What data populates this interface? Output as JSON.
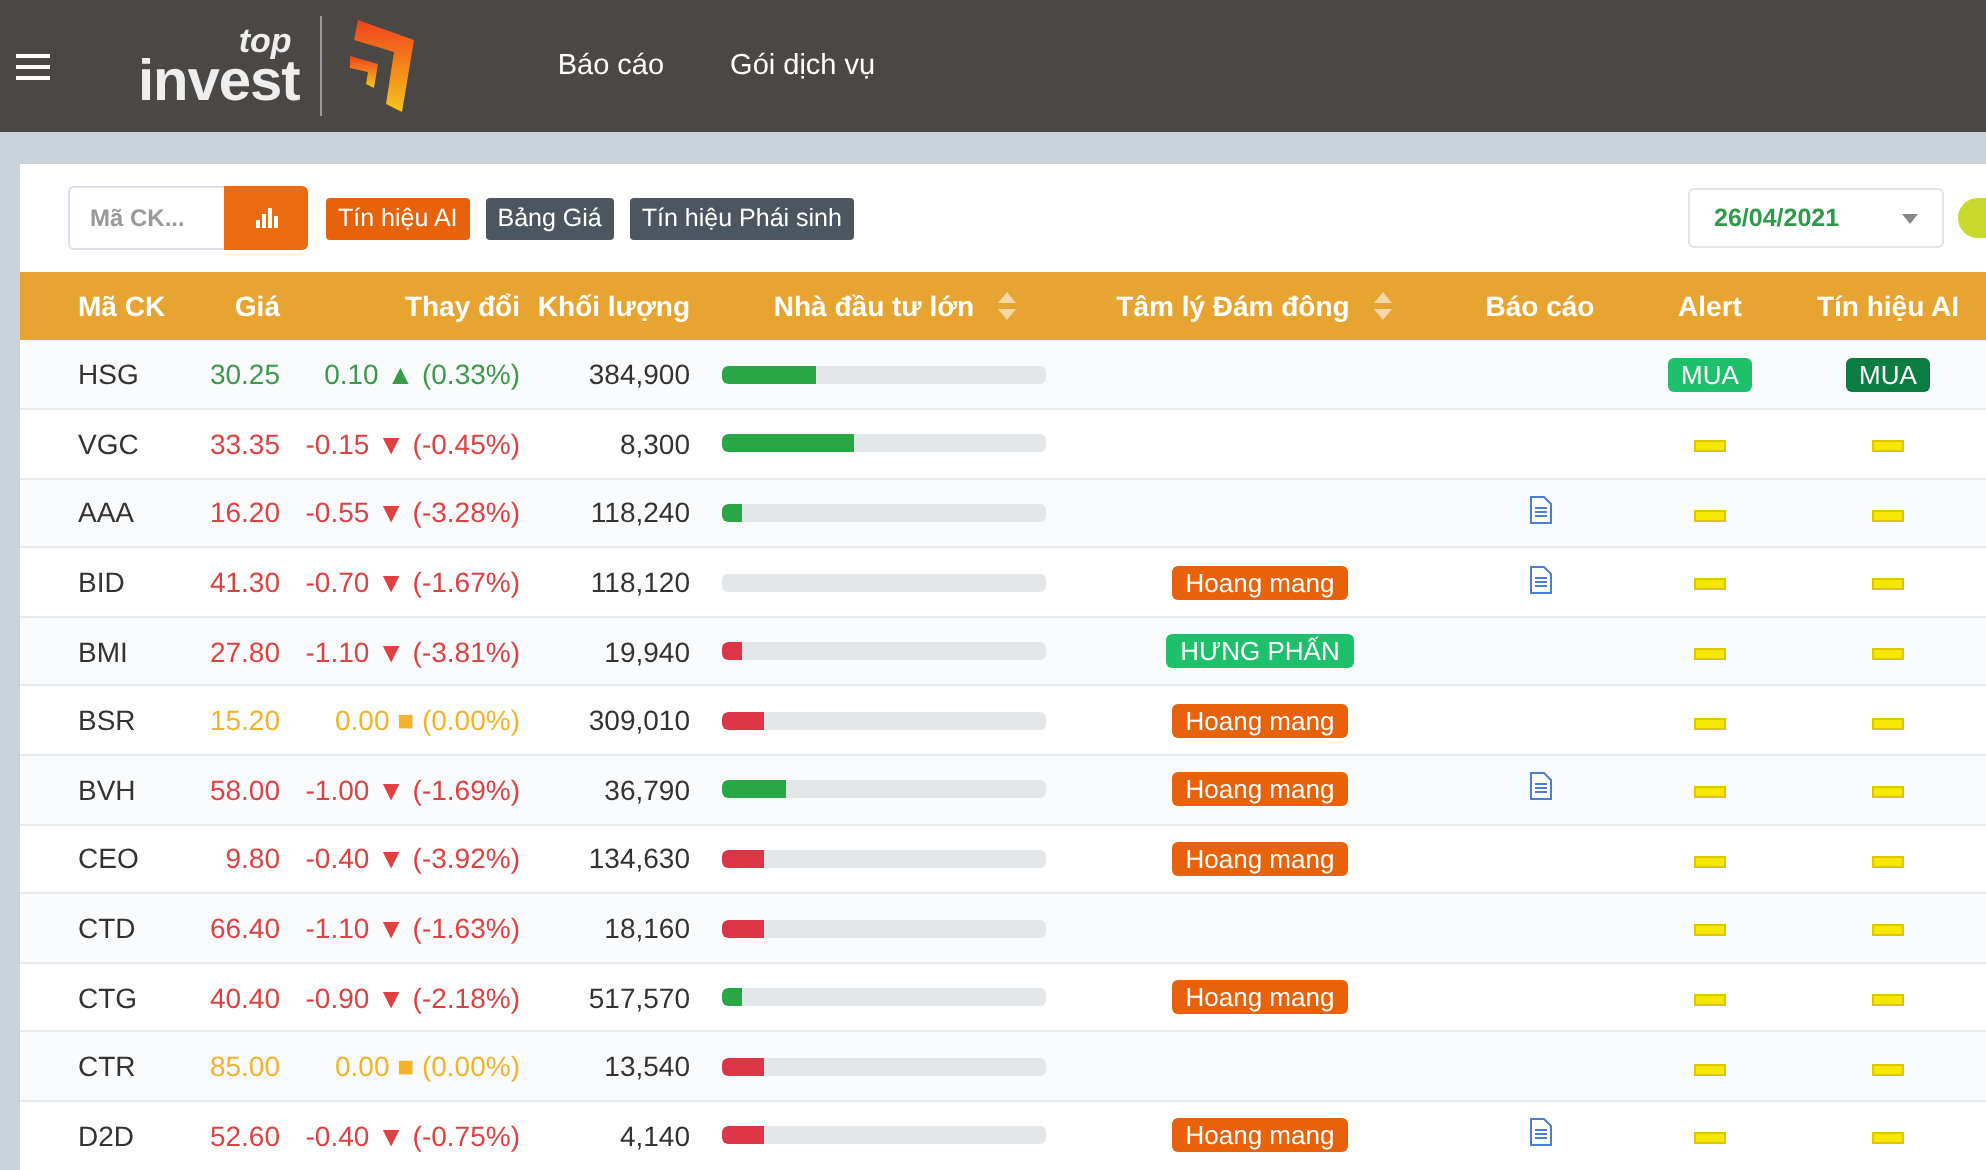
{
  "header": {
    "logo_top": "top",
    "logo_main": "invest",
    "nav": [
      "Báo cáo",
      "Gói dịch vụ"
    ]
  },
  "toolbar": {
    "search": {
      "placeholder": "Mã CK..."
    },
    "tabs": [
      {
        "label": "Tín hiệu AI",
        "selected": true
      },
      {
        "label": "Bảng Giá",
        "selected": false
      },
      {
        "label": "Tín hiệu Phái sinh",
        "selected": false
      }
    ],
    "date": "26/04/2021"
  },
  "table": {
    "columns": [
      {
        "label": "Mã CK",
        "sortable": false
      },
      {
        "label": "Giá",
        "sortable": false
      },
      {
        "label": "Thay đổi",
        "sortable": false
      },
      {
        "label": "Khối lượng",
        "sortable": false
      },
      {
        "label": "Nhà đầu tư lớn",
        "sortable": true
      },
      {
        "label": "Tâm lý Đám đông",
        "sortable": true
      },
      {
        "label": "Báo cáo",
        "sortable": false
      },
      {
        "label": "Alert",
        "sortable": false
      },
      {
        "label": "Tín hiệu AI",
        "sortable": false
      }
    ],
    "rows": [
      {
        "code": "HSG",
        "price": "30.25",
        "change": "0.10 ▲ (0.33%)",
        "kind": "up",
        "volume": "384,900",
        "level": 0.29,
        "color": "#28a745",
        "report": false,
        "alert": "MUA",
        "ai_signal": "MUA"
      },
      {
        "code": "VGC",
        "price": "33.35",
        "change": "-0.15 ▼ (-0.45%)",
        "kind": "down",
        "volume": "8,300",
        "level": 0.41,
        "color": "#28a745",
        "report": false
      },
      {
        "code": "AAA",
        "price": "16.20",
        "change": "-0.55 ▼ (-3.28%)",
        "kind": "down",
        "volume": "118,240",
        "level": 0.06,
        "color": "#28a745",
        "report": true
      },
      {
        "code": "BID",
        "price": "41.30",
        "change": "-0.70 ▼ (-1.67%)",
        "kind": "down",
        "volume": "118,120",
        "level": 0,
        "sentiment": {
          "label": "Hoang mang",
          "color": "#e8620c"
        },
        "report": true
      },
      {
        "code": "BMI",
        "price": "27.80",
        "change": "-1.10 ▼ (-3.81%)",
        "kind": "down",
        "volume": "19,940",
        "level": 0.06,
        "color": "#dc3545",
        "sentiment": {
          "label": "HƯNG PHẤN",
          "color": "#1ec06b"
        },
        "report": false
      },
      {
        "code": "BSR",
        "price": "15.20",
        "change": "0.00 ■ (0.00%)",
        "kind": "flat",
        "volume": "309,010",
        "level": 0.13,
        "color": "#dc3545",
        "sentiment": {
          "label": "Hoang mang",
          "color": "#e8620c"
        },
        "report": false
      },
      {
        "code": "BVH",
        "price": "58.00",
        "change": "-1.00 ▼ (-1.69%)",
        "kind": "down",
        "volume": "36,790",
        "level": 0.2,
        "color": "#28a745",
        "sentiment": {
          "label": "Hoang mang",
          "color": "#e8620c"
        },
        "report": true
      },
      {
        "code": "CEO",
        "price": "9.80",
        "change": "-0.40 ▼ (-3.92%)",
        "kind": "down",
        "volume": "134,630",
        "level": 0.13,
        "color": "#dc3545",
        "sentiment": {
          "label": "Hoang mang",
          "color": "#e8620c"
        },
        "report": false
      },
      {
        "code": "CTD",
        "price": "66.40",
        "change": "-1.10 ▼ (-1.63%)",
        "kind": "down",
        "volume": "18,160",
        "level": 0.13,
        "color": "#dc3545",
        "report": false
      },
      {
        "code": "CTG",
        "price": "40.40",
        "change": "-0.90 ▼ (-2.18%)",
        "kind": "down",
        "volume": "517,570",
        "level": 0.06,
        "color": "#28a745",
        "sentiment": {
          "label": "Hoang mang",
          "color": "#e8620c"
        },
        "report": false
      },
      {
        "code": "CTR",
        "price": "85.00",
        "change": "0.00 ■ (0.00%)",
        "kind": "flat",
        "volume": "13,540",
        "level": 0.13,
        "color": "#dc3545",
        "report": false
      },
      {
        "code": "D2D",
        "price": "52.60",
        "change": "-0.40 ▼ (-0.75%)",
        "kind": "down",
        "volume": "4,140",
        "level": 0.13,
        "color": "#dc3545",
        "sentiment": {
          "label": "Hoang mang",
          "color": "#e8620c"
        },
        "report": true
      }
    ]
  }
}
